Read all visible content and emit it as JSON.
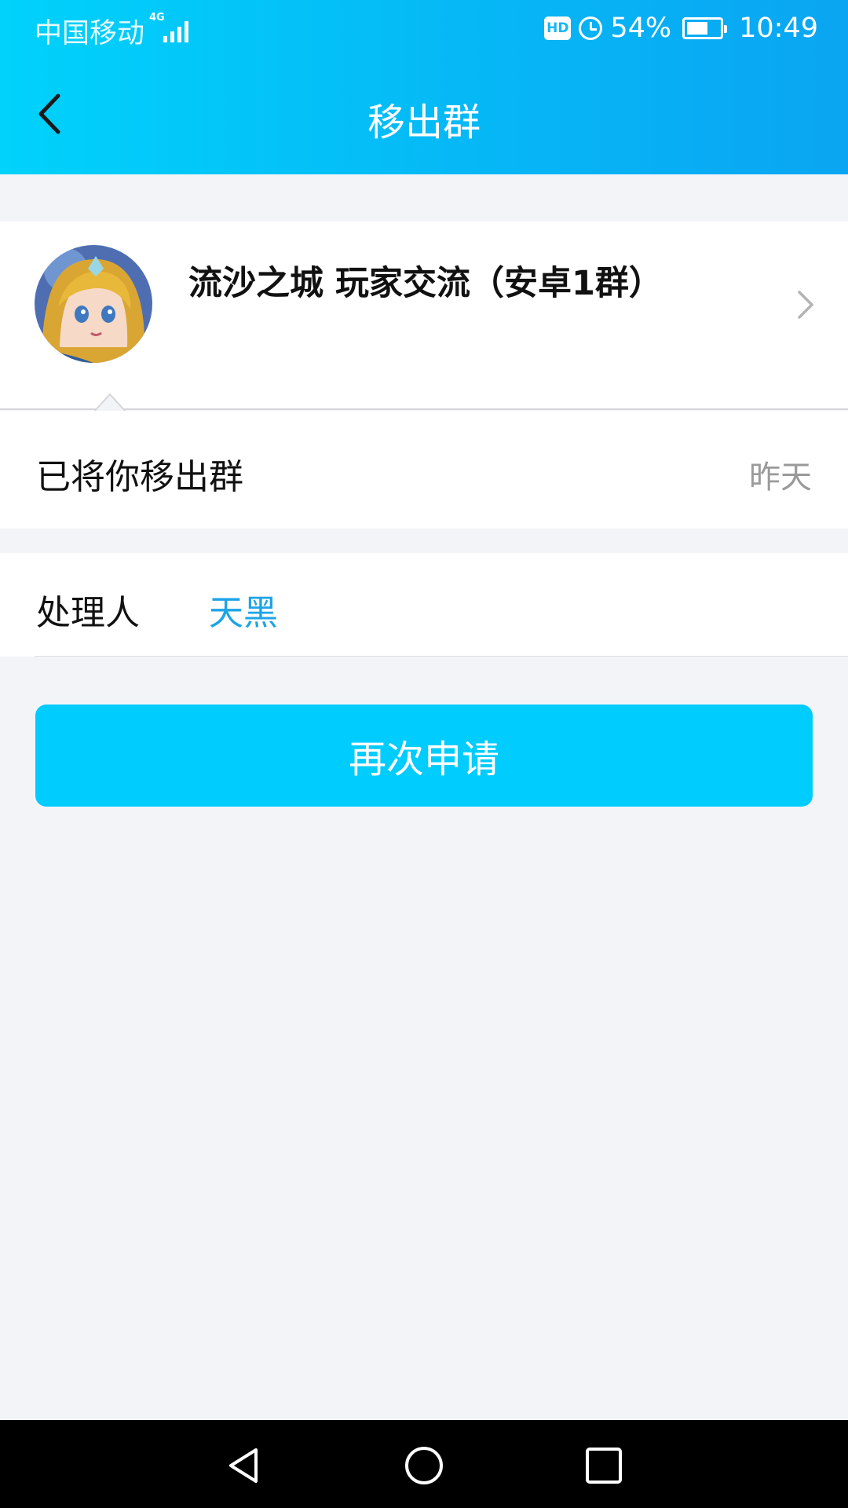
{
  "status_bar": {
    "carrier": "中国移动",
    "network": "4G",
    "hd": "HD",
    "battery": "54%",
    "time": "10:49"
  },
  "header": {
    "title": "移出群",
    "back_icon": "back-chevron-icon"
  },
  "group": {
    "name": "流沙之城 玩家交流（安卓1群）",
    "avatar_icon": "group-avatar",
    "chevron_icon": "chevron-right-icon"
  },
  "notice": {
    "text": "已将你移出群",
    "time": "昨天"
  },
  "handler": {
    "label": "处理人",
    "name": "天黑"
  },
  "actions": {
    "reapply": "再次申请"
  },
  "nav_bar": {
    "icons": [
      "back-triangle-icon",
      "home-circle-icon",
      "recents-square-icon"
    ]
  },
  "colors": {
    "header_start": "#00d2fb",
    "header_end": "#0aa5f2",
    "button": "#00ccfd",
    "link": "#1ea4e6",
    "background": "#f3f4f8"
  }
}
